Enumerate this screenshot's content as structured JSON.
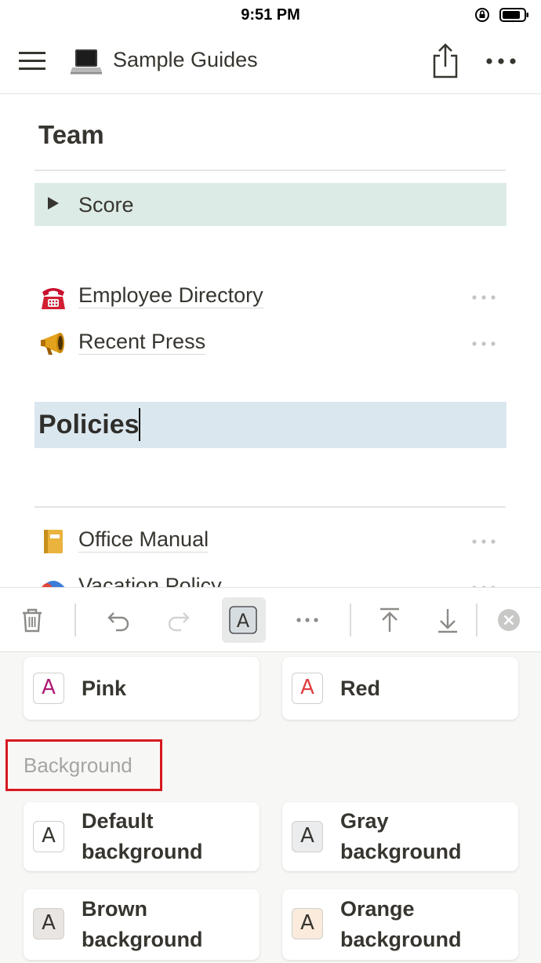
{
  "status_bar": {
    "time": "9:51 PM"
  },
  "nav": {
    "title": "Sample Guides",
    "icons": [
      "hamburger-menu-icon",
      "laptop-icon",
      "share-icon",
      "more-options-icon"
    ]
  },
  "page": {
    "team_heading": "Team",
    "toggle_label": "Score",
    "links_top": [
      {
        "label": "Employee Directory",
        "icon": "telephone-icon"
      },
      {
        "label": "Recent Press",
        "icon": "megaphone-icon"
      }
    ],
    "policies_heading": "Policies",
    "links_bottom": [
      {
        "label": "Office Manual",
        "icon": "notebook-icon"
      },
      {
        "label": "Vacation Policy",
        "icon": "umbrella-icon"
      }
    ]
  },
  "toolbar": {
    "icons": [
      "trash-icon",
      "undo-icon",
      "redo-icon",
      "text-color-icon",
      "more-icon",
      "move-to-top-icon",
      "move-down-icon",
      "close-icon"
    ],
    "text_color_glyph": "A"
  },
  "color_panel": {
    "text_colors": [
      {
        "label": "Pink",
        "glyph": "A",
        "color": "#ad1a72"
      },
      {
        "label": "Red",
        "glyph": "A",
        "color": "#e03e3e"
      }
    ],
    "background_section_label": "Background",
    "background_colors": [
      {
        "label_line1": "Default",
        "label_line2": "background",
        "glyph": "A",
        "bg": "#ffffff"
      },
      {
        "label_line1": "Gray",
        "label_line2": "background",
        "glyph": "A",
        "bg": "#ebeced"
      },
      {
        "label_line1": "Brown",
        "label_line2": "background",
        "glyph": "A",
        "bg": "#e9e5e3"
      },
      {
        "label_line1": "Orange",
        "label_line2": "background",
        "glyph": "A",
        "bg": "#faebdd"
      }
    ]
  },
  "colors": {
    "toggle_bg": "#ddebe6",
    "policies_bg": "#dbe7ef",
    "highlight_border": "#d71920",
    "panel_bg": "#f7f7f5"
  }
}
